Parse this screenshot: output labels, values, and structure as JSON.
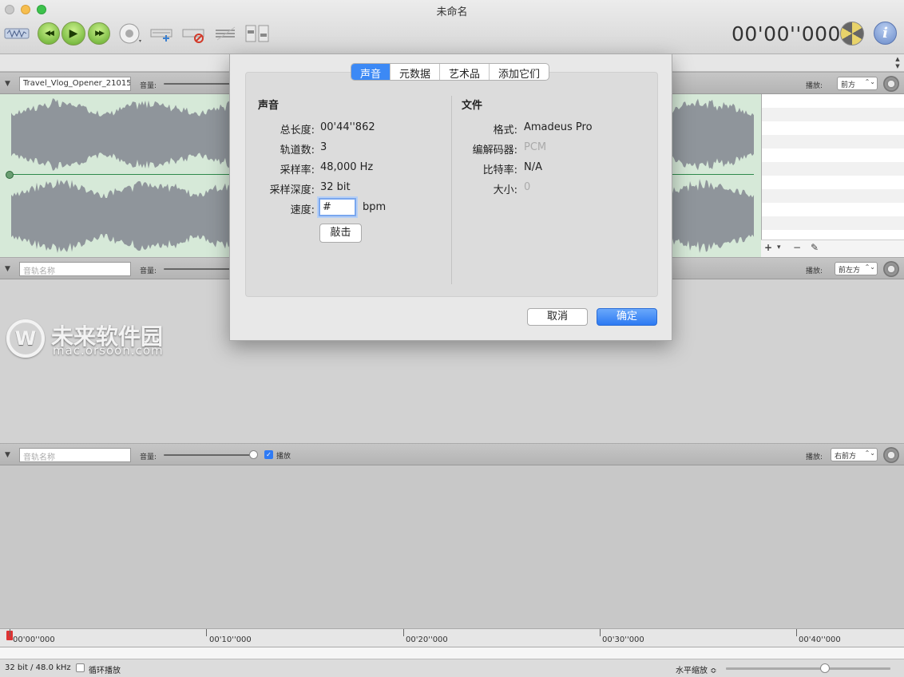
{
  "window": {
    "title": "未命名",
    "timecode": "00'00''000"
  },
  "toolbar": {
    "icons": [
      "waveform-view-icon",
      "rewind-icon",
      "play-icon",
      "fast-forward-icon",
      "record-icon",
      "add-track-icon",
      "delete-track-icon",
      "mixer-icon",
      "settings-slider-icon",
      "radioactive-icon",
      "info-icon"
    ],
    "rewind_glyph": "◀◀",
    "play_glyph": "▶",
    "ff_glyph": "▶▶",
    "info_glyph": "i"
  },
  "tracks": [
    {
      "name": "Travel_Vlog_Opener_21015",
      "placeholder": "",
      "volume_label": "音量:",
      "playback_label": "播放:",
      "channel": "前方"
    },
    {
      "name": "",
      "placeholder": "音轨名称",
      "volume_label": "音量:",
      "playback_label": "播放:",
      "channel": "前左方"
    },
    {
      "name": "",
      "placeholder": "音轨名称",
      "volume_label": "音量:",
      "playback_label": "播放:",
      "channel": "右前方",
      "play_checkbox_label": "播放",
      "play_checked": true
    }
  ],
  "watermark": {
    "logo": "W",
    "text": "未来软件园",
    "url": "mac.orsoon.com"
  },
  "timeline": {
    "labels": [
      "00'00''000",
      "00'10''000",
      "00'20''000",
      "00'30''000",
      "00'40''000"
    ]
  },
  "statusbar": {
    "format": "32 bit / 48.0 kHz",
    "loop_label": "循环播放",
    "loop_checked": false,
    "zoom_label": "水平缩放 ≎",
    "zoom_level": 0.6
  },
  "dialog": {
    "tabs": [
      {
        "label": "声音",
        "active": true
      },
      {
        "label": "元数据",
        "active": false
      },
      {
        "label": "艺术品",
        "active": false
      },
      {
        "label": "添加它们",
        "active": false
      }
    ],
    "sound": {
      "heading": "声音",
      "fields": [
        {
          "label": "总长度:",
          "value": "00'44''862"
        },
        {
          "label": "轨道数:",
          "value": "3"
        },
        {
          "label": "采样率:",
          "value": "48,000 Hz"
        },
        {
          "label": "采样深度:",
          "value": "32 bit"
        }
      ],
      "tempo_label": "速度:",
      "tempo_value": "#",
      "tempo_unit": "bpm",
      "tap_button": "敲击"
    },
    "file": {
      "heading": "文件",
      "fields": [
        {
          "label": "格式:",
          "value": "Amadeus Pro",
          "dim": false
        },
        {
          "label": "编解码器:",
          "value": "PCM",
          "dim": true
        },
        {
          "label": "比特率:",
          "value": "N/A",
          "dim": false
        },
        {
          "label": "大小:",
          "value": "0",
          "dim": true
        }
      ]
    },
    "cancel_button": "取消",
    "ok_button": "确定"
  },
  "marker_bar": {
    "add": "+",
    "menu": "▾",
    "remove": "−",
    "edit": "✎"
  }
}
